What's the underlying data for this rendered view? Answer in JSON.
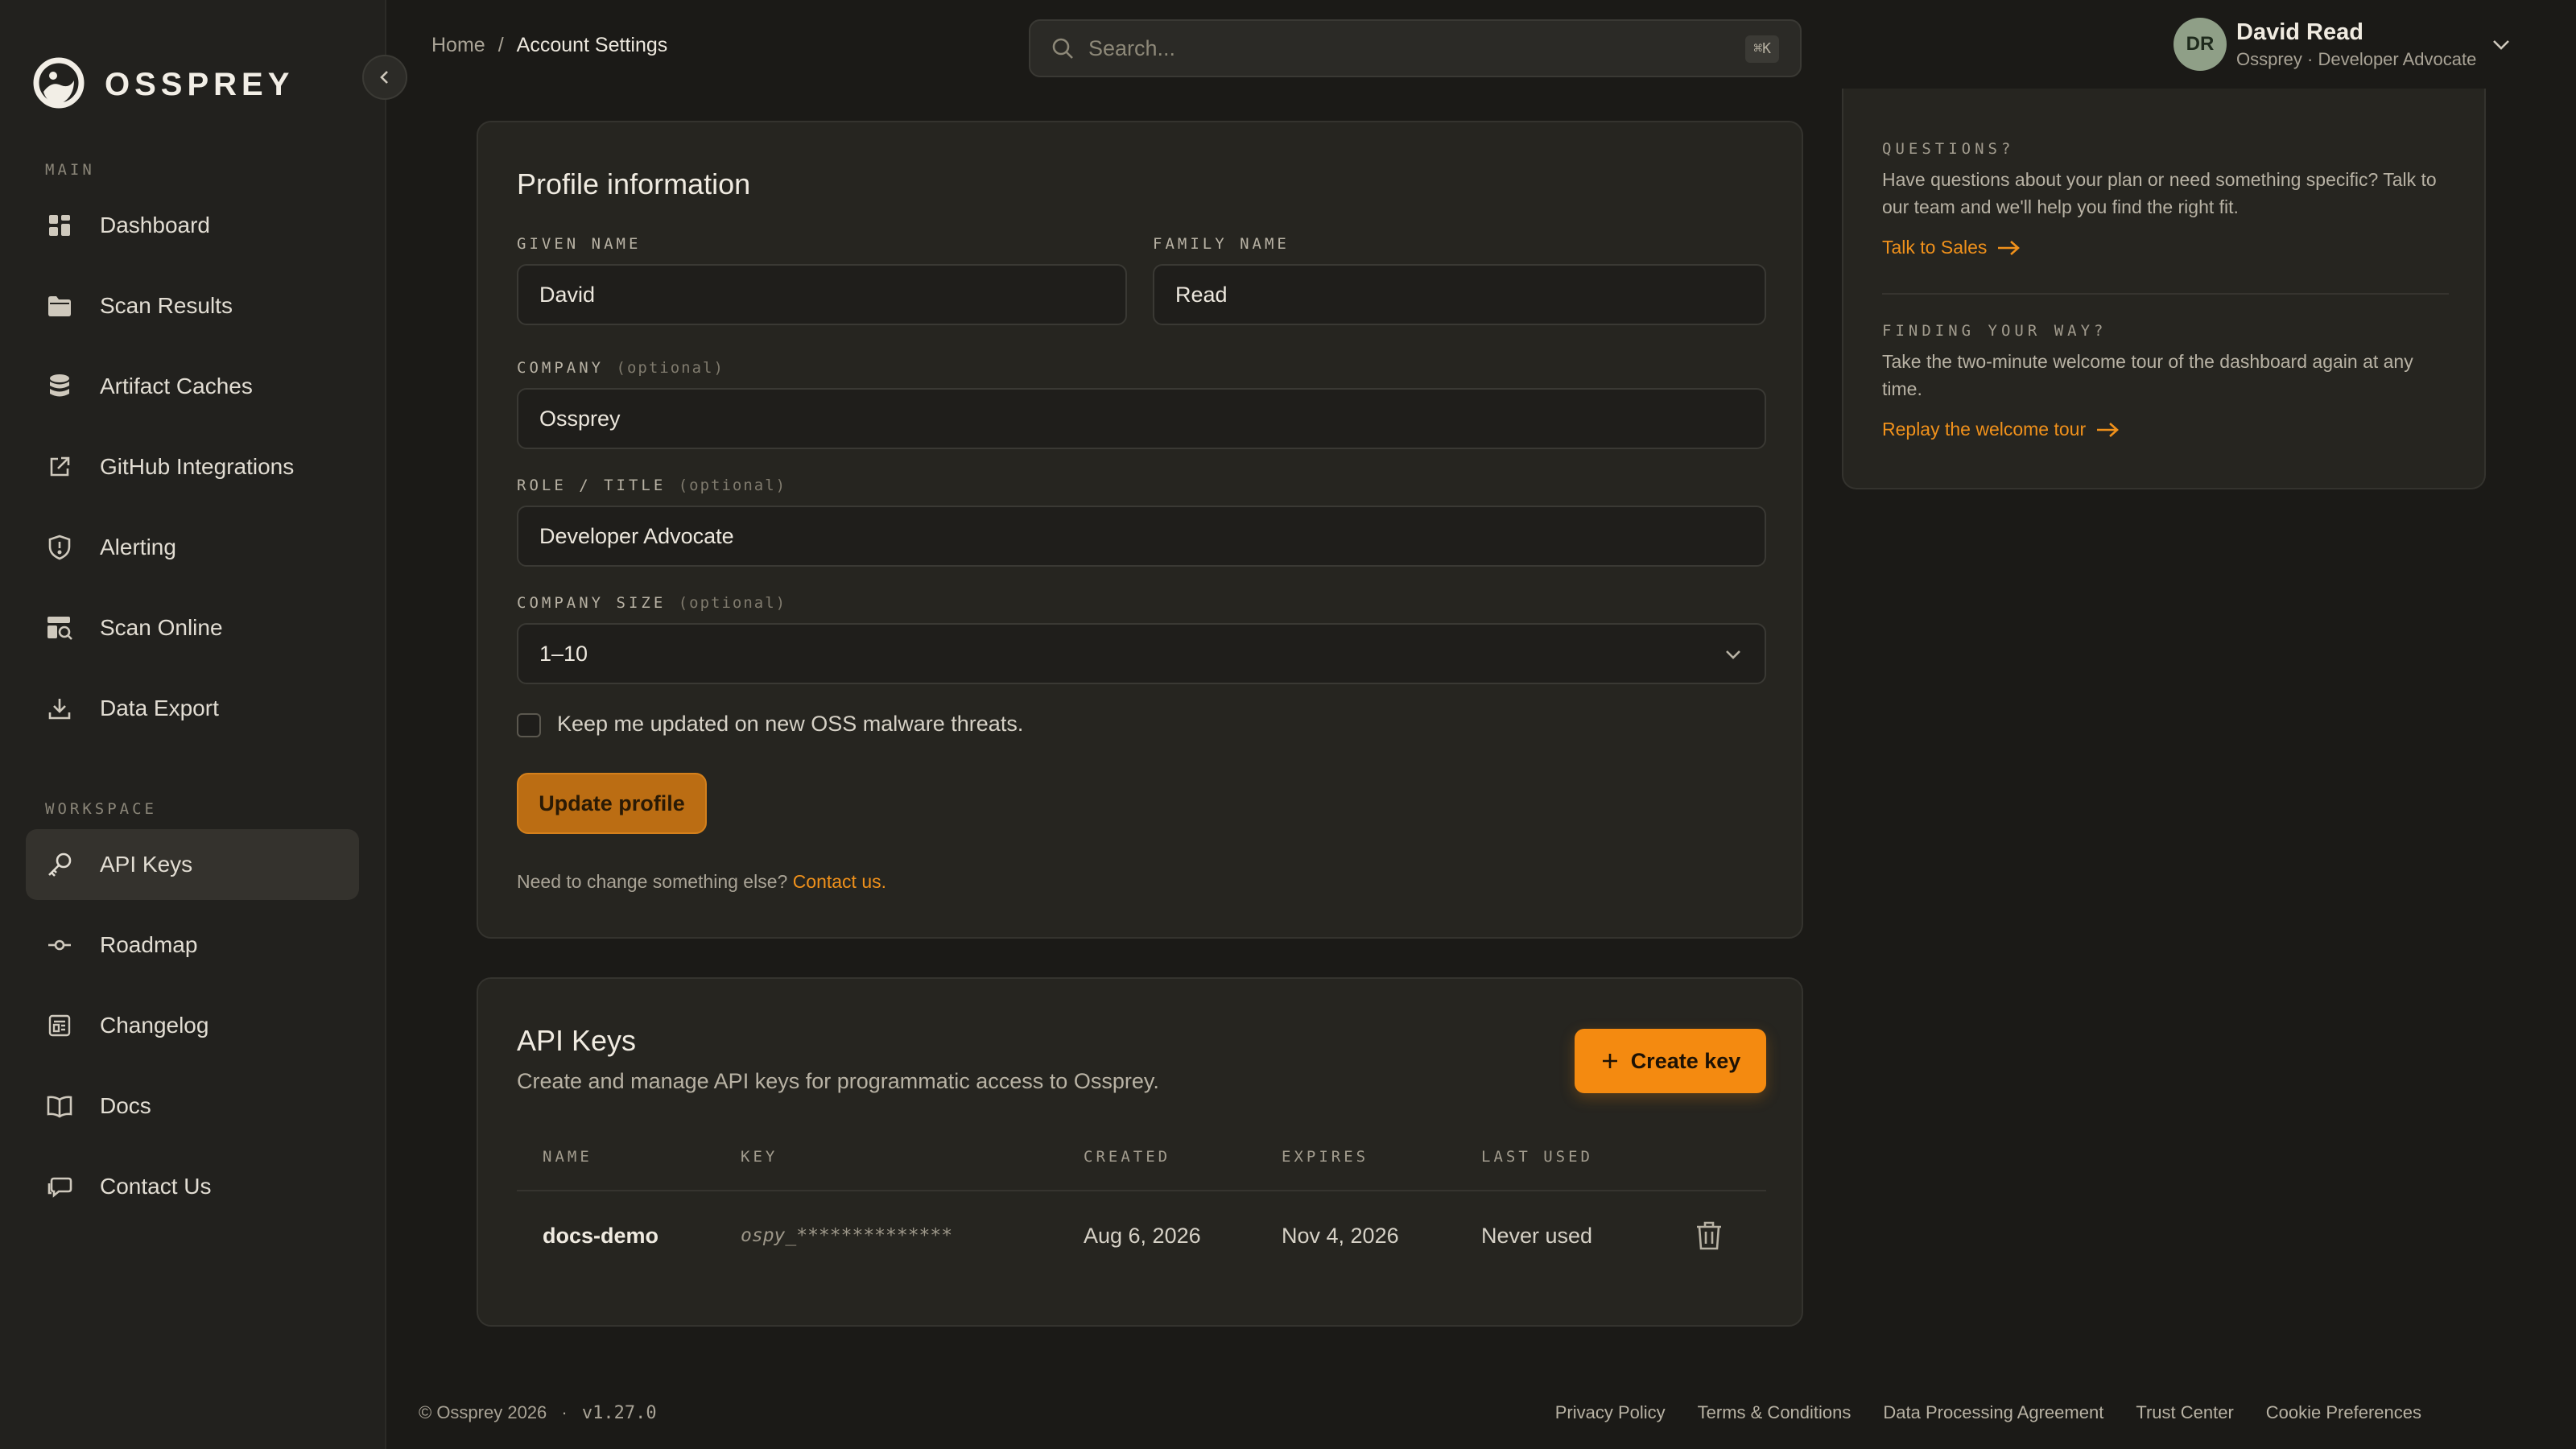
{
  "app": {
    "brand": "OSSPREY"
  },
  "sidebar": {
    "main_label": "MAIN",
    "workspace_label": "WORKSPACE",
    "main_items": [
      {
        "label": "Dashboard",
        "icon": "dashboard-icon"
      },
      {
        "label": "Scan Results",
        "icon": "folder-icon"
      },
      {
        "label": "Artifact Caches",
        "icon": "database-icon"
      },
      {
        "label": "GitHub Integrations",
        "icon": "external-link-icon"
      },
      {
        "label": "Alerting",
        "icon": "shield-alert-icon"
      },
      {
        "label": "Scan Online",
        "icon": "scan-online-icon"
      },
      {
        "label": "Data Export",
        "icon": "download-icon"
      }
    ],
    "workspace_items": [
      {
        "label": "API Keys",
        "icon": "key-icon",
        "active": true
      },
      {
        "label": "Roadmap",
        "icon": "roadmap-icon"
      },
      {
        "label": "Changelog",
        "icon": "changelog-icon"
      },
      {
        "label": "Docs",
        "icon": "book-icon"
      },
      {
        "label": "Contact Us",
        "icon": "chat-icon"
      }
    ]
  },
  "header": {
    "breadcrumb": [
      "Home",
      "/",
      "Account Settings"
    ],
    "search_placeholder": "Search...",
    "search_shortcut": "⌘K",
    "user": {
      "initials": "DR",
      "name": "David Read",
      "subtitle": "Ossprey · Developer Advocate"
    }
  },
  "profile": {
    "title": "Profile information",
    "given_name_label": "GIVEN NAME",
    "given_name": "David",
    "family_name_label": "FAMILY NAME",
    "family_name": "Read",
    "company_label": "COMPANY",
    "company": "Ossprey",
    "role_label": "ROLE / TITLE",
    "role": "Developer Advocate",
    "size_label": "COMPANY SIZE",
    "size": "1–10",
    "optional": "(optional)",
    "checkbox_label": "Keep me updated on new OSS malware threats.",
    "checkbox_checked": false,
    "update_button": "Update profile",
    "note_prefix": "Need to change something else?",
    "note_link": "Contact us."
  },
  "api_keys": {
    "title": "API Keys",
    "subtitle": "Create and manage API keys for programmatic access to Ossprey.",
    "create_button": "Create key",
    "columns": [
      "NAME",
      "KEY",
      "CREATED",
      "EXPIRES",
      "LAST USED"
    ],
    "rows": [
      {
        "name": "docs-demo",
        "key": "ospy_**************",
        "created": "Aug 6, 2026",
        "expires": "Nov 4, 2026",
        "last_used": "Never used"
      }
    ]
  },
  "help": {
    "questions_label": "QUESTIONS?",
    "questions_text": "Have questions about your plan or need something specific? Talk to our team and we'll help you find the right fit.",
    "questions_link": "Talk to Sales",
    "tour_label": "FINDING YOUR WAY?",
    "tour_text": "Take the two-minute welcome tour of the dashboard again at any time.",
    "tour_link": "Replay the welcome tour"
  },
  "footer": {
    "copyright": "© Ossprey 2026",
    "separator": "·",
    "version": "v1.27.0",
    "links": [
      "Privacy Policy",
      "Terms & Conditions",
      "Data Processing Agreement",
      "Trust Center",
      "Cookie Preferences"
    ]
  },
  "colors": {
    "accent": "#f48a10",
    "background": "#1b1a17",
    "sidebar": "#22211e",
    "card": "#262520"
  }
}
